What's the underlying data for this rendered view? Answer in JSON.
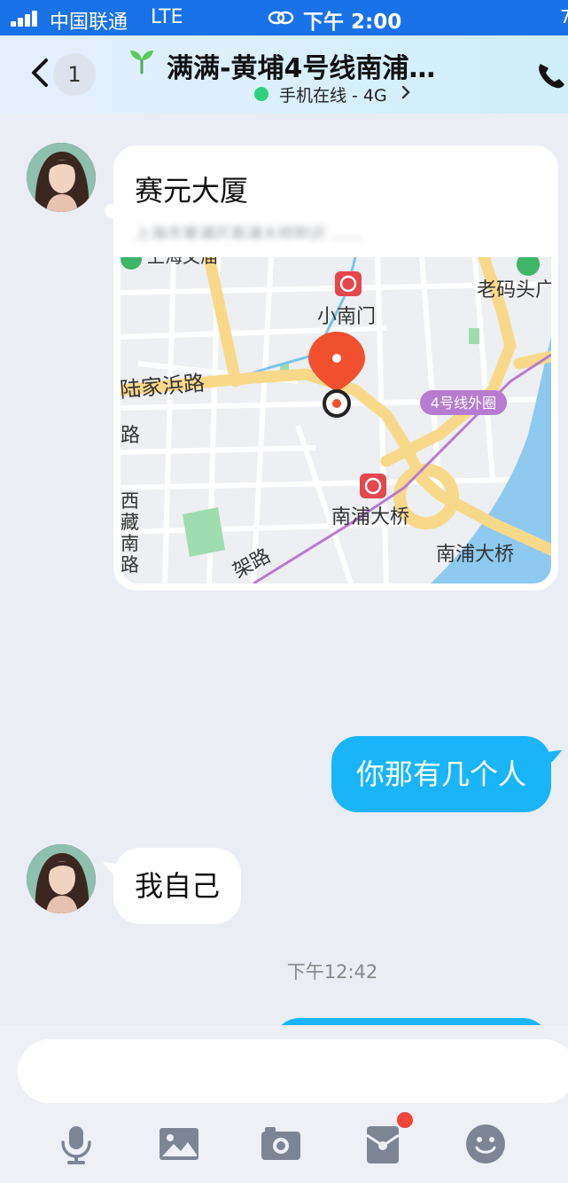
{
  "status_bar": {
    "carrier": "中国联通",
    "network": "LTE",
    "time": "下午 2:00",
    "edge_fragment": "7"
  },
  "header": {
    "back_count": "1",
    "title": "满满-黄埔4号线南浦…",
    "online_status": "手机在线 - 4G"
  },
  "messages": {
    "location": {
      "name": "赛元大厦",
      "address_blurred": "上海市黄浦区南浦大桥附近 ……",
      "map_labels": {
        "top_left": "上海文庙",
        "station_1": "小南门",
        "top_right": "老码头广",
        "road_1": "陆家浜路",
        "road_2": "路",
        "line_badge": "4号线外圈",
        "station_2": "南浦大桥",
        "bridge": "南浦大桥",
        "road_3": "西藏南路",
        "road_4": "架路"
      }
    },
    "outgoing_1": "你那有几个人",
    "incoming_1": "我自己",
    "timestamp": "下午12:42"
  },
  "input": {
    "value": "",
    "placeholder": ""
  },
  "toolbar": {
    "icons": [
      "microphone-icon",
      "image-icon",
      "camera-icon",
      "red-packet-icon",
      "emoji-icon"
    ],
    "badge_color": "#f0453a"
  },
  "colors": {
    "status_bar": "#1a72e8",
    "outgoing_bubble": "#1ab5f9",
    "online_dot": "#2fd27a",
    "map_pin": "#f1502f",
    "metro_icon": "#e2484e"
  }
}
